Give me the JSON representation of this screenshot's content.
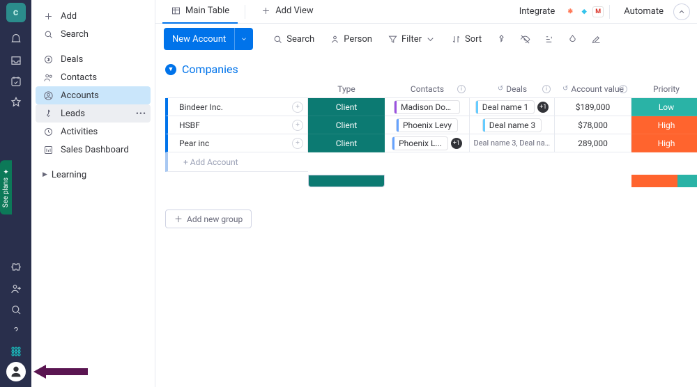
{
  "rail": {
    "see_plans_label": "See plans"
  },
  "sidebar": {
    "add_label": "Add",
    "search_label": "Search",
    "items": [
      {
        "label": "Deals"
      },
      {
        "label": "Contacts"
      },
      {
        "label": "Accounts"
      },
      {
        "label": "Leads"
      },
      {
        "label": "Activities"
      },
      {
        "label": "Sales Dashboard"
      }
    ],
    "learning_label": "Learning"
  },
  "tabs": {
    "main_table": "Main Table",
    "add_view": "Add View",
    "integrate": "Integrate",
    "automate": "Automate"
  },
  "toolbar": {
    "new_account": "New Account",
    "search": "Search",
    "person": "Person",
    "filter": "Filter",
    "sort": "Sort"
  },
  "group": {
    "title": "Companies",
    "columns": [
      "",
      "Type",
      "Contacts",
      "Deals",
      "Account value",
      "Priority"
    ],
    "add_account": "+ Add Account",
    "add_group": "Add new group",
    "rows": [
      {
        "name": "Bindeer Inc.",
        "type": "Client",
        "contact": "Madison Doyle",
        "contact_bar": "#9b51e0",
        "deal": "Deal name 1",
        "deal_bar": "#66ccff",
        "deal_extra": "+1",
        "value": "$189,000",
        "priority": "Low",
        "priority_color": "#2ab3a6"
      },
      {
        "name": "HSBF",
        "type": "Client",
        "contact": "Phoenix Levy",
        "contact_bar": "#66a3ff",
        "deal": "Deal name 3",
        "deal_bar": "#66ccff",
        "deal_extra": "",
        "value": "$78,000",
        "priority": "High",
        "priority_color": "#ff642e"
      },
      {
        "name": "Pear inc",
        "type": "Client",
        "contact": "Phoenix L...",
        "contact_bar": "#66a3ff",
        "contact_extra": "+1",
        "deal": "",
        "deal_text_only": "Deal name 3, Deal na...",
        "value": "289,000",
        "priority": "High",
        "priority_color": "#ff642e"
      }
    ]
  }
}
